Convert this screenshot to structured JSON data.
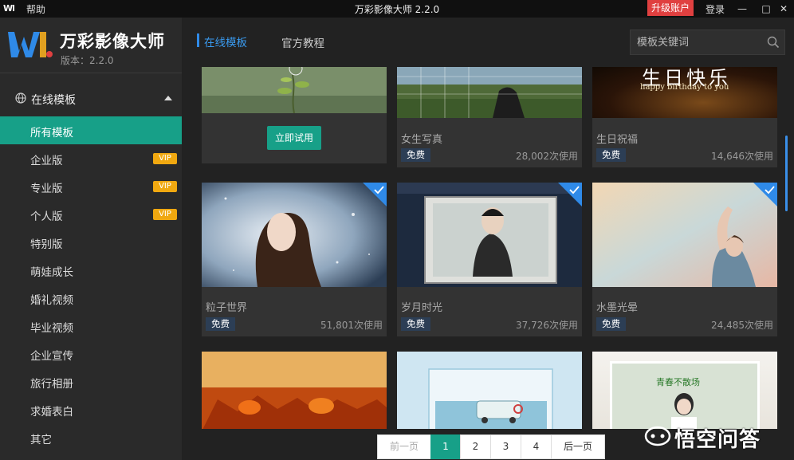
{
  "titlebar": {
    "logo_text": "Wl",
    "help": "帮助",
    "title": "万彩影像大师 2.2.0",
    "upgrade": "升级账户",
    "login": "登录",
    "minimize": "—",
    "maximize": "□",
    "close": "✕"
  },
  "sidebar": {
    "brand_name": "万彩影像大师",
    "version": "版本：2.2.0",
    "section_label": "在线模板",
    "items": [
      {
        "label": "所有模板",
        "vip": ""
      },
      {
        "label": "企业版",
        "vip": "VIP"
      },
      {
        "label": "专业版",
        "vip": "VIP"
      },
      {
        "label": "个人版",
        "vip": "VIP"
      },
      {
        "label": "特别版",
        "vip": ""
      },
      {
        "label": "萌娃成长",
        "vip": ""
      },
      {
        "label": "婚礼视频",
        "vip": ""
      },
      {
        "label": "毕业视频",
        "vip": ""
      },
      {
        "label": "企业宣传",
        "vip": ""
      },
      {
        "label": "旅行相册",
        "vip": ""
      },
      {
        "label": "求婚表白",
        "vip": ""
      },
      {
        "label": "其它",
        "vip": ""
      }
    ]
  },
  "header": {
    "tab_online": "在线模板",
    "tab_tutorial": "官方教程",
    "search_placeholder": "模板关键词"
  },
  "cards": [
    {
      "title": "",
      "badge": "",
      "uses": "",
      "try_label": "立即试用"
    },
    {
      "title": "女生写真",
      "badge": "免费",
      "uses": "28,002次使用"
    },
    {
      "title": "生日祝福",
      "badge": "免费",
      "uses": "14,646次使用",
      "thumb_text": "生日快乐",
      "thumb_subtext": "happy birthday to you"
    },
    {
      "title": "粒子世界",
      "badge": "免费",
      "uses": "51,801次使用"
    },
    {
      "title": "岁月时光",
      "badge": "免费",
      "uses": "37,726次使用"
    },
    {
      "title": "水墨光晕",
      "badge": "免费",
      "uses": "24,485次使用"
    },
    {
      "title": "",
      "badge": "",
      "uses": ""
    },
    {
      "title": "",
      "badge": "",
      "uses": ""
    },
    {
      "title": "",
      "badge": "",
      "uses": "",
      "thumb_text": "青春不散场"
    }
  ],
  "pager": {
    "prev": "前一页",
    "pages": [
      "1",
      "2",
      "3",
      "4"
    ],
    "next": "后一页",
    "current": "1"
  },
  "watermark": "悟空问答",
  "colors": {
    "accent": "#17a088",
    "tab_blue": "#3a9bf0",
    "vip": "#f0a810",
    "upgrade": "#e04040"
  }
}
